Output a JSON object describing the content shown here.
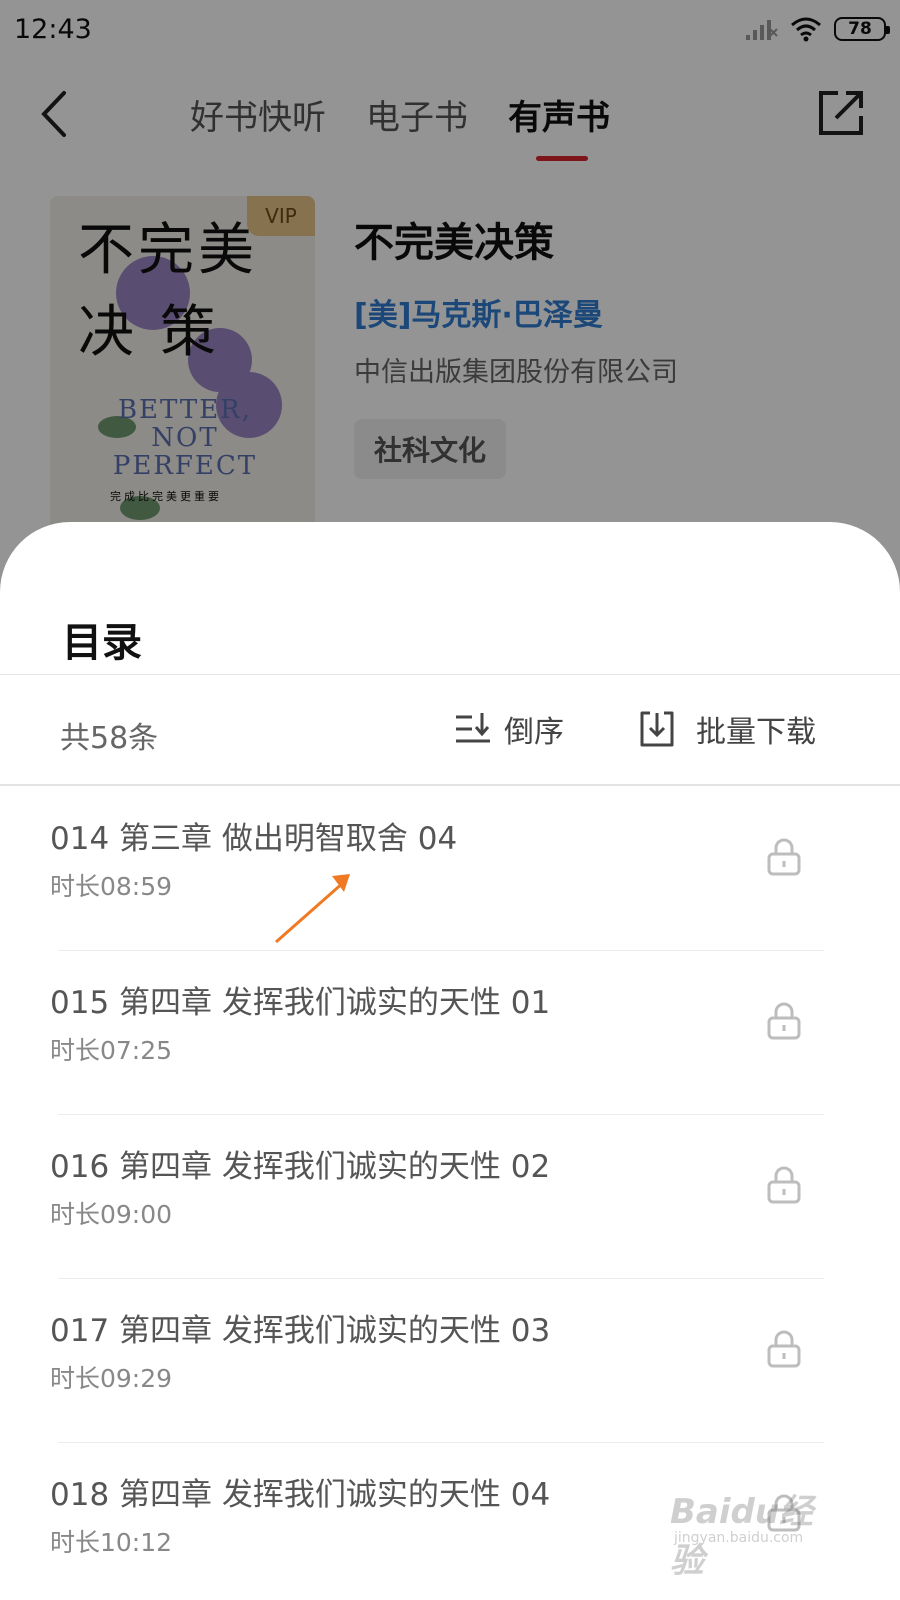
{
  "status_bar": {
    "time": "12:43",
    "battery": "78"
  },
  "nav": {
    "tabs": [
      {
        "label": "好书快听",
        "active": false
      },
      {
        "label": "电子书",
        "active": false
      },
      {
        "label": "有声书",
        "active": true
      }
    ]
  },
  "book": {
    "cover_title_line1": "不完美",
    "cover_title_line2": "决 策",
    "cover_badge": "VIP",
    "cover_english": "BETTER, NOT PERFECT",
    "cover_subtitle": "完成比完美更重要",
    "title": "不完美决策",
    "author": "[美]马克斯·巴泽曼",
    "publisher": "中信出版集团股份有限公司",
    "category": "社科文化"
  },
  "catalog": {
    "title": "目录",
    "count": "共58条",
    "reverse_label": "倒序",
    "download_label": "批量下载",
    "items": [
      {
        "title": "014 第三章 做出明智取舍 04",
        "duration": "时长08:59"
      },
      {
        "title": "015 第四章 发挥我们诚实的天性 01",
        "duration": "时长07:25"
      },
      {
        "title": "016 第四章 发挥我们诚实的天性 02",
        "duration": "时长09:00"
      },
      {
        "title": "017 第四章 发挥我们诚实的天性 03",
        "duration": "时长09:29"
      },
      {
        "title": "018 第四章 发挥我们诚实的天性 04",
        "duration": "时长10:12"
      }
    ]
  },
  "watermark": {
    "text": "Baidu经验",
    "sub": "jingyan.baidu.com"
  },
  "colors": {
    "accent": "#d9252f",
    "author_blue": "#2f7dd1",
    "annotation_orange": "#f07a24"
  }
}
